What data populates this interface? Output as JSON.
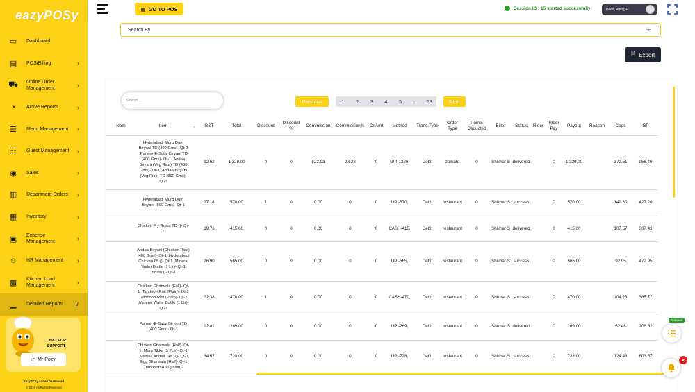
{
  "brand": {
    "logo_text": "eazyPOSy",
    "accent": "#fcd116",
    "dark": "#1f2533"
  },
  "sidebar": {
    "items": [
      {
        "label": "Dashboard",
        "icon": "monitor-icon",
        "chevron": false
      },
      {
        "label": "POS/Billing",
        "icon": "billing-icon",
        "chevron": true
      },
      {
        "label": "Online Order Management",
        "icon": "scooter-icon",
        "chevron": true
      },
      {
        "label": "Active Reports",
        "icon": "chart-icon",
        "chevron": true
      },
      {
        "label": "Menu Management",
        "icon": "list-icon",
        "chevron": true
      },
      {
        "label": "Guest Management",
        "icon": "guest-icon",
        "chevron": true
      },
      {
        "label": "Sales",
        "icon": "sales-icon",
        "chevron": true
      },
      {
        "label": "Department Orders",
        "icon": "building-icon",
        "chevron": true
      },
      {
        "label": "Inventory",
        "icon": "boxes-icon",
        "chevron": true
      },
      {
        "label": "Expense Management",
        "icon": "wallet-icon",
        "chevron": true
      },
      {
        "label": "HR Management",
        "icon": "people-icon",
        "chevron": true
      },
      {
        "label": "Kitchen Load Management",
        "icon": "kitchen-icon",
        "chevron": true
      },
      {
        "label": "Detailed Reports",
        "icon": "bar-chart-icon",
        "chevron": true,
        "active": true,
        "expanded": true
      }
    ],
    "support": {
      "text": "CHAT FOR SUPPORT",
      "button": "Mr Pozy"
    },
    "footer1": "EazyPOSy Admin Dashboard",
    "footer2": "© 2026 All Rights Reserved"
  },
  "topbar": {
    "go_to_pos": "GO TO POS",
    "session": "Session ID : 15 started successfully",
    "user": "Hello, Amit@R"
  },
  "main": {
    "search_by": "Search By",
    "export": "Export",
    "search_placeholder": "Search...",
    "pager": {
      "prev": "Previous",
      "pages": [
        "1",
        "2",
        "3",
        "4",
        "5",
        "...",
        "23"
      ],
      "next": "Next"
    }
  },
  "table": {
    "columns": [
      "Nam",
      "Item",
      ",",
      "GST",
      "Total",
      "Discount",
      "Discount %",
      "Commission",
      "Commission%",
      "Cr.Amt",
      "Method",
      "Trans.Type",
      "Order Type",
      "Points Deducted",
      "Biller",
      "Status",
      "Rider",
      "Rider Pay",
      "Payout",
      "Reason",
      "Cogs",
      "GP"
    ],
    "rows": [
      [
        "",
        "Hyderabadi Murg Dum Biryani TD (400 Gms)- Qt-2 ,Paneer-E-Sabz Biryani TD (400 Gms)- Qt-1 ,Andaa Biryani (Veg Rice) TD (400 Gms)- Qt-1 ,Andaa Biryani (Veg Rice) TD (800 Gms)- Qt-1",
        "",
        "92.62",
        "1,329.00",
        "0",
        "0",
        "522.93",
        "28.23",
        "0",
        "UPI-1329,",
        "Debit",
        "zomato",
        "0",
        "Shikhar S",
        "delivered",
        "",
        "0",
        "1,329.00",
        "",
        "372.51",
        "956.49"
      ],
      [
        "",
        "Hyderabadi Murg Dum Biryani (800 Gms)- Qt-1",
        "",
        "27.14",
        "570.00",
        "1",
        "0",
        "0.00",
        "0",
        "0",
        "UPI-570,",
        "Debit",
        "restaurant",
        "0",
        "Shikhar S",
        "success",
        "",
        "0",
        "570.00",
        "",
        "142.80",
        "427.20"
      ],
      [
        "",
        "Chicken Fry Roast TD ()- Qt-1",
        "",
        "19.76",
        "415.00",
        "0",
        "0",
        "0.00",
        "0",
        "0",
        "CASH-415,",
        "Debit",
        "restaurant",
        "0",
        "Shikhar S",
        "delivered",
        "",
        "0",
        "415.00",
        "",
        "107.57",
        "307.43"
      ],
      [
        "",
        "Andaa Biryani (Chicken Rice) (400 Gms)- Qt-1 ,Hyderabadi Chicken 65 ()- Qt-1 ,Mineral Water Bottle (1 Ltr)- Qt-1 ,Bristo ()- Qt-1",
        "",
        "26.90",
        "565.00",
        "0",
        "0",
        "0.00",
        "0",
        "0",
        "UPI-565,",
        "Debit",
        "restaurant",
        "0",
        "Shikhar S",
        "success",
        "",
        "0",
        "565.00",
        "",
        "92.05",
        "472.95"
      ],
      [
        "",
        "Chicken Gharwala (Full)- Qt-1 ,Tandoori Roti (Plain)- Qt-2 ,Tandoori Roti (Plain)- Qt-2 ,Mineral Water Bottle (1 Ltr)- Qt-1",
        "",
        "22.38",
        "470.00",
        "1",
        "0",
        "0.00",
        "0",
        "0",
        "CASH-470,",
        "Debit",
        "restaurant",
        "0",
        "Shikhar S",
        "success",
        "",
        "0",
        "470.00",
        "",
        "104.23",
        "365.77"
      ],
      [
        "",
        "Paneer-E-Sabz Biryani TD (400 Gms)- Qt-1",
        "",
        "12.81",
        "269.00",
        "0",
        "0",
        "0.00",
        "0",
        "0",
        "UPI-269,",
        "Debit",
        "restaurant",
        "0",
        "Shikhar S",
        "delivered",
        "",
        "0",
        "269.00",
        "",
        "62.48",
        "206.52"
      ],
      [
        "",
        "Chicken Gharwala (Half)- Qt-1 ,Murg Tikka (3 Pcs)- Qt-1 ,Masala Andaa 1PC ()- Qt-1 ,Egg Gharwala (Half)- Qt-1 ,Tandoori Roti (Plain)-",
        "",
        "34.67",
        "728.00",
        "0",
        "0",
        "0.00",
        "0",
        "0",
        "UPI-728,",
        "Debit",
        "restaurant",
        "0",
        "Shikhar S",
        "success",
        "",
        "0",
        "728.00",
        "",
        "124.43",
        "603.57"
      ]
    ]
  },
  "widgets": {
    "notepad": "Notepad"
  }
}
